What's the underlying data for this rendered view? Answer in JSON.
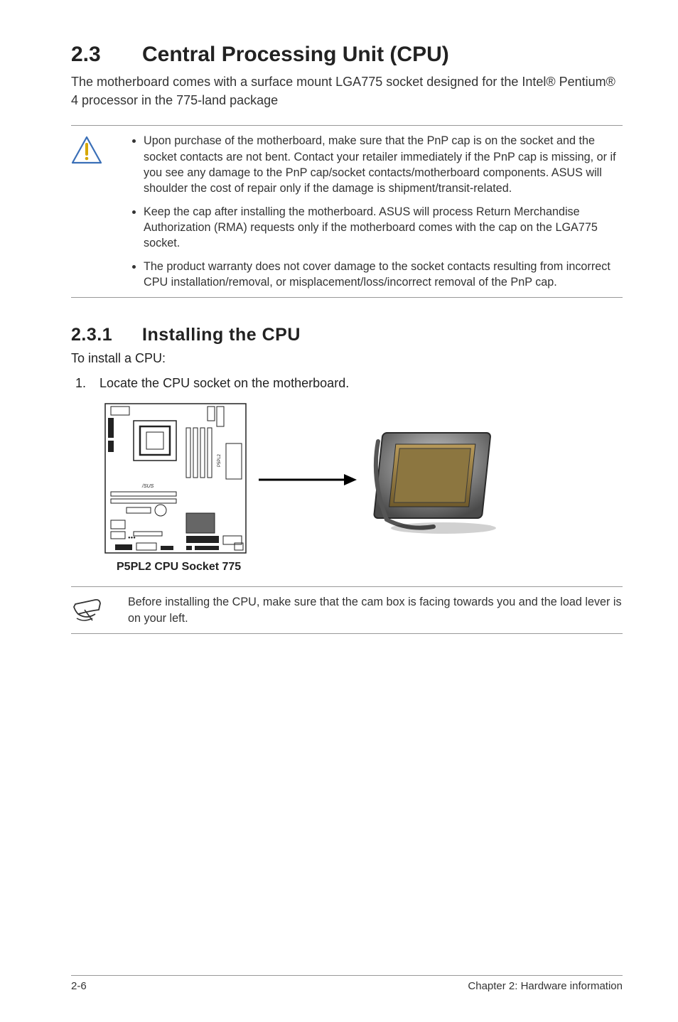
{
  "section": {
    "number": "2.3",
    "title": "Central Processing Unit (CPU)",
    "intro": "The motherboard comes with a surface mount LGA775 socket designed for the Intel® Pentium®  4 processor in the 775-land package"
  },
  "warning_bullets": [
    "Upon purchase of the motherboard, make sure that the PnP cap is on the socket and the socket contacts are not bent. Contact your retailer immediately if the PnP cap is missing, or if you see any damage to the PnP cap/socket contacts/motherboard components. ASUS will shoulder the cost of repair only if the damage is shipment/transit-related.",
    "Keep the cap after installing the motherboard. ASUS will process Return Merchandise Authorization (RMA) requests only if the motherboard comes with the cap on the LGA775 socket.",
    "The product warranty does not cover damage to the socket contacts resulting from incorrect CPU installation/removal, or misplacement/loss/incorrect removal of the PnP cap."
  ],
  "subsection": {
    "number": "2.3.1",
    "title": "Installing the CPU",
    "lead": "To install a CPU:",
    "step1": "Locate the CPU socket on the motherboard."
  },
  "figure": {
    "caption": "P5PL2 CPU Socket 775"
  },
  "tip_text": "Before installing the CPU, make sure that the cam box is facing towards you and the load lever is on your left.",
  "footer": {
    "page": "2-6",
    "chapter": "Chapter 2: Hardware information"
  }
}
